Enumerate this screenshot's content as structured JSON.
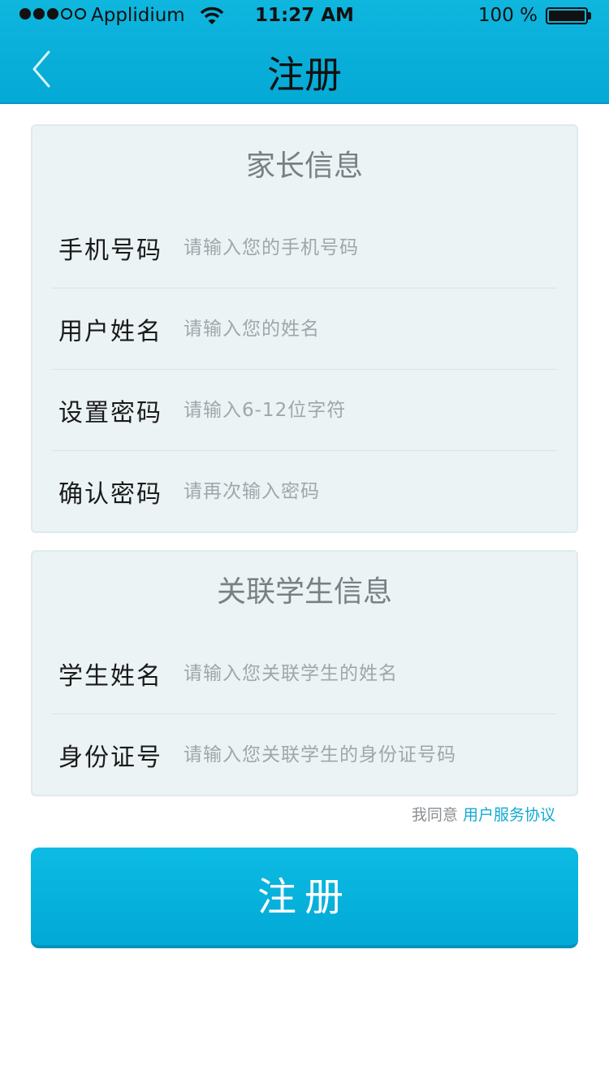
{
  "status_bar": {
    "carrier": "Applidium",
    "time": "11:27 AM",
    "battery": "100 %",
    "signal_bars_filled": 3,
    "signal_bars_total": 5
  },
  "nav": {
    "back_icon": "chevron-left-icon",
    "title": "注册"
  },
  "parent_section": {
    "title": "家长信息",
    "fields": [
      {
        "label": "手机号码",
        "placeholder": "请输入您的手机号码",
        "value": ""
      },
      {
        "label": "用户姓名",
        "placeholder": "请输入您的姓名",
        "value": ""
      },
      {
        "label": "设置密码",
        "placeholder": "请输入6-12位字符",
        "value": ""
      },
      {
        "label": "确认密码",
        "placeholder": "请再次输入密码",
        "value": ""
      }
    ]
  },
  "student_section": {
    "title": "关联学生信息",
    "fields": [
      {
        "label": "学生姓名",
        "placeholder": "请输入您关联学生的姓名",
        "value": ""
      },
      {
        "label": "身份证号",
        "placeholder": "请输入您关联学生的身份证号码",
        "value": ""
      }
    ]
  },
  "agreement": {
    "prefix": "我同意",
    "link": "用户服务协议"
  },
  "register_button": "注册",
  "colors": {
    "accent": "#04a9d5",
    "card_bg": "#ebf3f5",
    "link": "#13a9d3"
  }
}
